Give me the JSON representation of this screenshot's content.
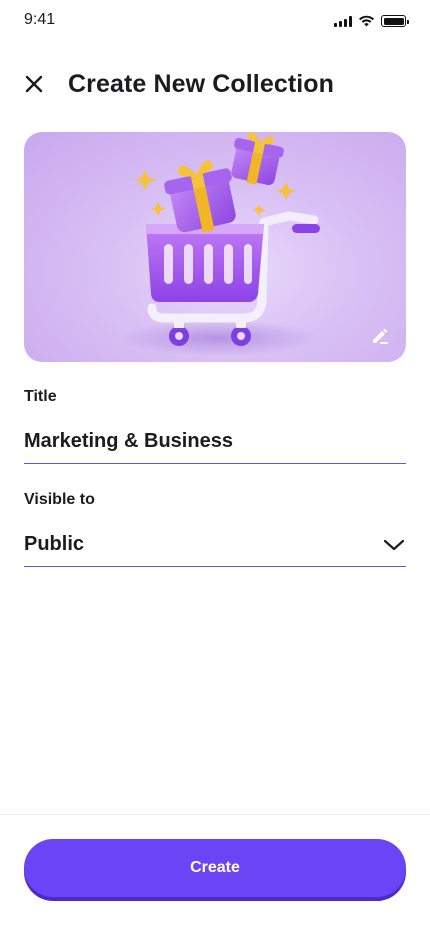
{
  "status_bar": {
    "time": "9:41",
    "icons": [
      "cellular-signal-icon",
      "wifi-icon",
      "battery-icon"
    ]
  },
  "header": {
    "close_icon": "close-icon",
    "title": "Create New Collection"
  },
  "cover": {
    "image": "shopping-cart-with-gift-boxes-illustration",
    "edit_icon": "pencil-edit-icon"
  },
  "form": {
    "title_label": "Title",
    "title_value": "Marketing & Business",
    "visibility_label": "Visible to",
    "visibility_value": "Public",
    "visibility_icon": "chevron-down-icon"
  },
  "footer": {
    "create_label": "Create"
  },
  "colors": {
    "accent": "#6a44f5",
    "underline": "#6b4ef0",
    "text": "#1c1c1e",
    "cover_bg": "#d8bff4"
  }
}
